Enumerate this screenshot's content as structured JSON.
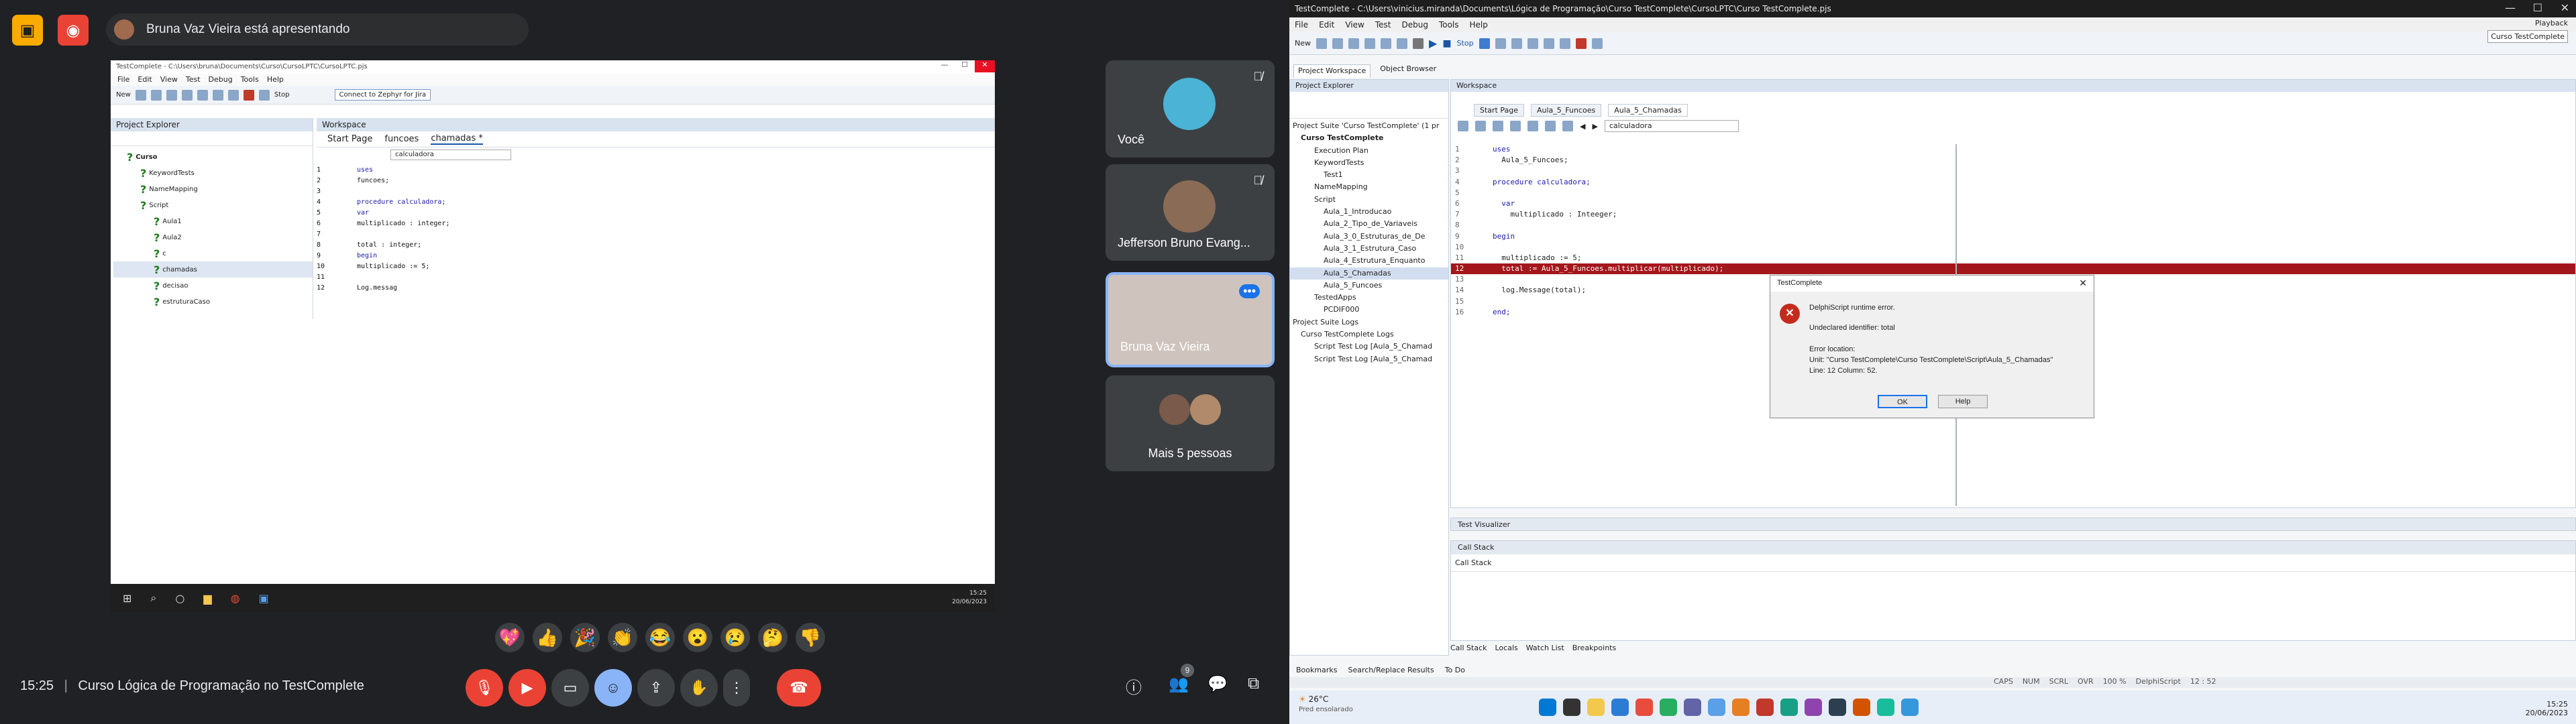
{
  "meet": {
    "presenting_text": "Bruna Vaz Vieira está apresentando",
    "time": "15:25",
    "meeting_title": "Curso Lógica de Programação no TestComplete",
    "participants": [
      {
        "name": "Você"
      },
      {
        "name": "Jefferson Bruno Evang..."
      },
      {
        "name": "Bruna Vaz Vieira"
      },
      {
        "name": "Mais 5 pessoas"
      }
    ],
    "people_count": "9",
    "reactions": [
      "💖",
      "👍",
      "🎉",
      "👏",
      "😂",
      "😮",
      "😢",
      "🤔",
      "👎"
    ],
    "icons": {
      "camera_off": "camera-off-icon",
      "record": "record-icon",
      "mic_off": "mic-off-icon",
      "hand": "raise-hand-icon"
    }
  },
  "shared": {
    "title": "TestComplete - C:\\Users\\bruna\\Documents\\Curso\\CursoLPTC\\CursoLPTC.pjs",
    "menu": [
      "File",
      "Edit",
      "View",
      "Test",
      "Debug",
      "Tools",
      "Help"
    ],
    "new_label": "New",
    "stop_label": "Stop",
    "zephyr": "Connect to Zephyr for Jira",
    "project_explorer": "Project Explorer",
    "workspace": "Workspace",
    "tree": [
      "Curso",
      "KeywordTests",
      "NameMapping",
      "Script",
      "Aula1",
      "Aula2",
      "c",
      "chamadas",
      "decisao",
      "estruturaCaso"
    ],
    "tabs": [
      "Start Page",
      "funcoes",
      "chamadas *"
    ],
    "routine": "calculadora",
    "code": [
      "uses",
      "  funcoes;",
      "",
      "procedure calculadora;",
      "var",
      "  multiplicado : integer;",
      "",
      "  total : integer;",
      "begin",
      "  multiplicado := 5;",
      "",
      "  Log.messag"
    ],
    "clock_time": "15:25",
    "clock_date": "20/06/2023"
  },
  "tc": {
    "title": "TestComplete - C:\\Users\\vinicius.miranda\\Documents\\Lógica de Programação\\Curso TestComplete\\CursoLPTC\\Curso TestComplete.pjs",
    "menu": [
      "File",
      "Edit",
      "View",
      "Test",
      "Debug",
      "Tools",
      "Help"
    ],
    "new_label": "New",
    "stop_label": "Stop",
    "playback": "Playback",
    "playback_tip": "Curso TestComplete",
    "explorer_tabs": [
      "Project Workspace",
      "Object Browser"
    ],
    "project_explorer": "Project Explorer",
    "workspace": "Workspace",
    "tree": [
      "Project Suite 'Curso TestComplete' (1 pr",
      "Curso TestComplete",
      "Execution Plan",
      "KeywordTests",
      "Test1",
      "NameMapping",
      "Script",
      "Aula_1_Introducao",
      "Aula_2_Tipo_de_Variaveis",
      "Aula_3_0_Estruturas_de_De",
      "Aula_3_1_Estrutura_Caso",
      "Aula_4_Estrutura_Enquanto",
      "Aula_5_Chamadas",
      "Aula_5_Funcoes",
      "TestedApps",
      "PCDIF000",
      "Project Suite Logs",
      "Curso TestComplete Logs",
      "Script Test Log [Aula_5_Chamad",
      "Script Test Log [Aula_5_Chamad"
    ],
    "ws_tabs": [
      "Start Page",
      "Aula_5_Funcoes",
      "Aula_5_Chamadas"
    ],
    "routine": "calculadora",
    "code": [
      "uses",
      "  Aula_5_Funcoes;",
      "",
      "procedure calculadora;",
      "",
      "  var",
      "    multiplicado : Inteeger;",
      "",
      "begin",
      "",
      "  multiplicado := 5;",
      "  total := Aula_5_Funcoes.multiplicar(multiplicado);",
      "",
      "  log.Message(total);",
      "",
      "end;"
    ],
    "dialog": {
      "title": "TestComplete",
      "line1": "DelphiScript runtime error.",
      "line2": "Undeclared identifier: total",
      "line3": "Error location:",
      "line4": "Unit: \"Curso TestComplete\\Curso TestComplete\\Script\\Aula_5_Chamadas\"",
      "line5": "Line: 12 Column: 52.",
      "ok": "OK",
      "help": "Help"
    },
    "visualizer": "Test Visualizer",
    "callstack": "Call Stack",
    "callstack_col": "Call Stack",
    "bottom_tabs": [
      "Call Stack",
      "Locals",
      "Watch List",
      "Breakpoints"
    ],
    "bookmark_tabs": [
      "Bookmarks",
      "Search/Replace Results",
      "To Do"
    ],
    "status": [
      "CAPS",
      "NUM",
      "SCRL",
      "OVR",
      "100 %",
      "DelphiScript",
      "12 : 52"
    ],
    "weather_temp": "26°C",
    "weather_desc": "Pred ensolarado",
    "clock_time": "15:25",
    "clock_date": "20/06/2023"
  }
}
